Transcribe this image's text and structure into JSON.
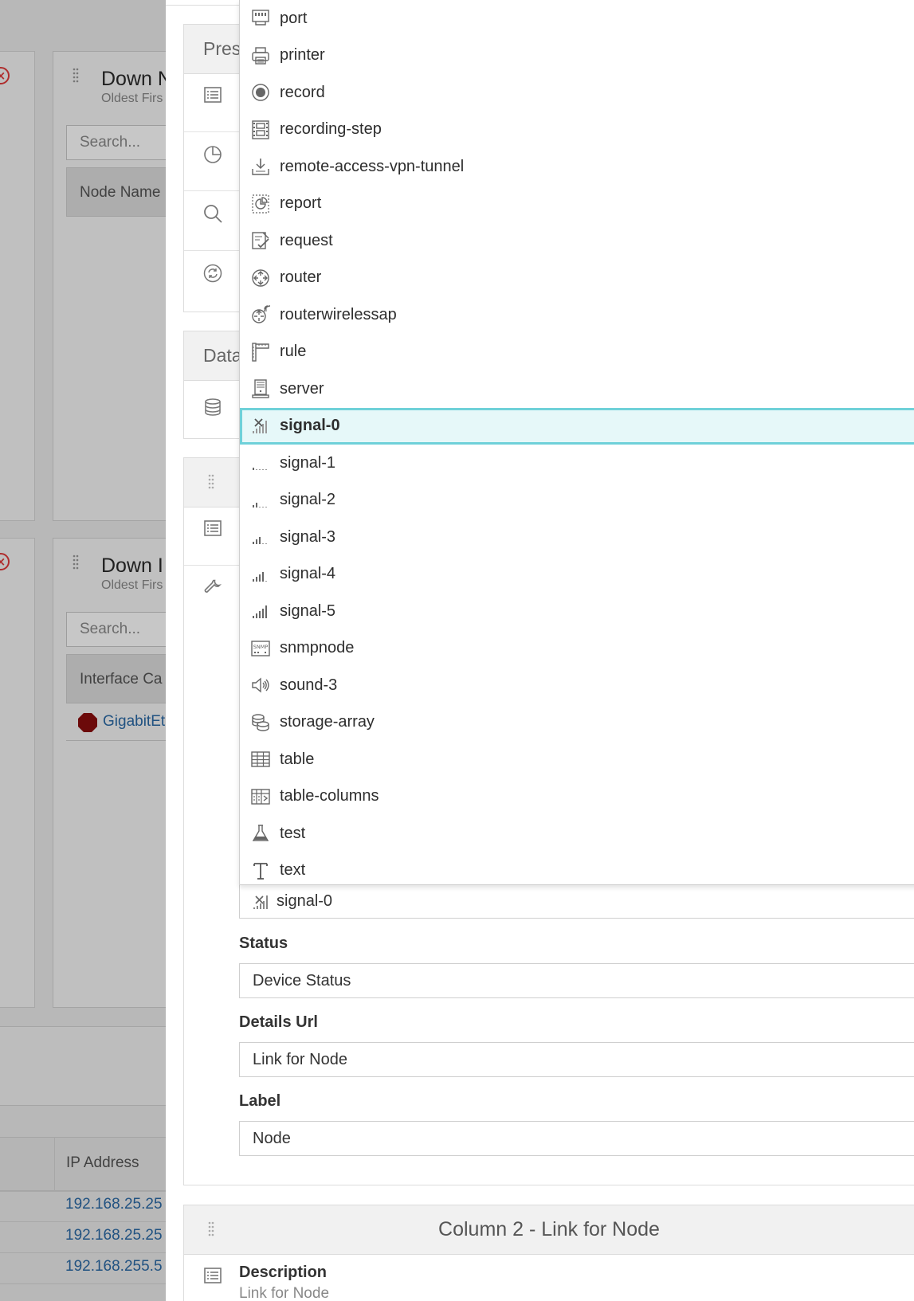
{
  "background": {
    "cards": [
      {
        "title": "Down N",
        "subtitle": "Oldest Firs",
        "search_placeholder": "Search...",
        "column": "Node Name"
      },
      {
        "title": "Down I",
        "subtitle": "Oldest Firs",
        "search_placeholder": "Search...",
        "column": "Interface Ca",
        "first_row": "GigabitEt"
      }
    ],
    "table": {
      "column": "IP Address",
      "rows": [
        "192.168.25.25",
        "192.168.25.25",
        "192.168.255.5"
      ]
    }
  },
  "panel": {
    "section_presentation": "Pres",
    "section_data": "Data",
    "column1": {
      "icon_label": "signal-0",
      "status_label": "Status",
      "status_value": "Device Status",
      "details_url_label": "Details Url",
      "details_url_value": "Link for Node",
      "label_label": "Label",
      "label_value": "Node"
    },
    "column2": {
      "title": "Column 2 - Link for Node",
      "description_label": "Description",
      "description_value": "Link for Node"
    }
  },
  "dropdown": {
    "selected": "signal-0",
    "items": [
      {
        "label": "port",
        "icon": "port-icon"
      },
      {
        "label": "printer",
        "icon": "printer-icon"
      },
      {
        "label": "record",
        "icon": "record-icon"
      },
      {
        "label": "recording-step",
        "icon": "recording-step-icon"
      },
      {
        "label": "remote-access-vpn-tunnel",
        "icon": "remote-access-vpn-tunnel-icon"
      },
      {
        "label": "report",
        "icon": "report-icon"
      },
      {
        "label": "request",
        "icon": "request-icon"
      },
      {
        "label": "router",
        "icon": "router-icon"
      },
      {
        "label": "routerwirelessap",
        "icon": "routerwirelessap-icon"
      },
      {
        "label": "rule",
        "icon": "rule-icon"
      },
      {
        "label": "server",
        "icon": "server-icon"
      },
      {
        "label": "signal-0",
        "icon": "signal-0-icon"
      },
      {
        "label": "signal-1",
        "icon": "signal-1-icon"
      },
      {
        "label": "signal-2",
        "icon": "signal-2-icon"
      },
      {
        "label": "signal-3",
        "icon": "signal-3-icon"
      },
      {
        "label": "signal-4",
        "icon": "signal-4-icon"
      },
      {
        "label": "signal-5",
        "icon": "signal-5-icon"
      },
      {
        "label": "snmpnode",
        "icon": "snmpnode-icon"
      },
      {
        "label": "sound-3",
        "icon": "sound-3-icon"
      },
      {
        "label": "storage-array",
        "icon": "storage-array-icon"
      },
      {
        "label": "table",
        "icon": "table-icon"
      },
      {
        "label": "table-columns",
        "icon": "table-columns-icon"
      },
      {
        "label": "test",
        "icon": "test-icon"
      },
      {
        "label": "text",
        "icon": "text-icon"
      }
    ]
  },
  "colors": {
    "selected_border": "#6fd1d9",
    "selected_background": "#e6f8f9",
    "link": "#2b6aa6",
    "error": "#e03a3a",
    "status_critical": "#8b0d0d"
  }
}
